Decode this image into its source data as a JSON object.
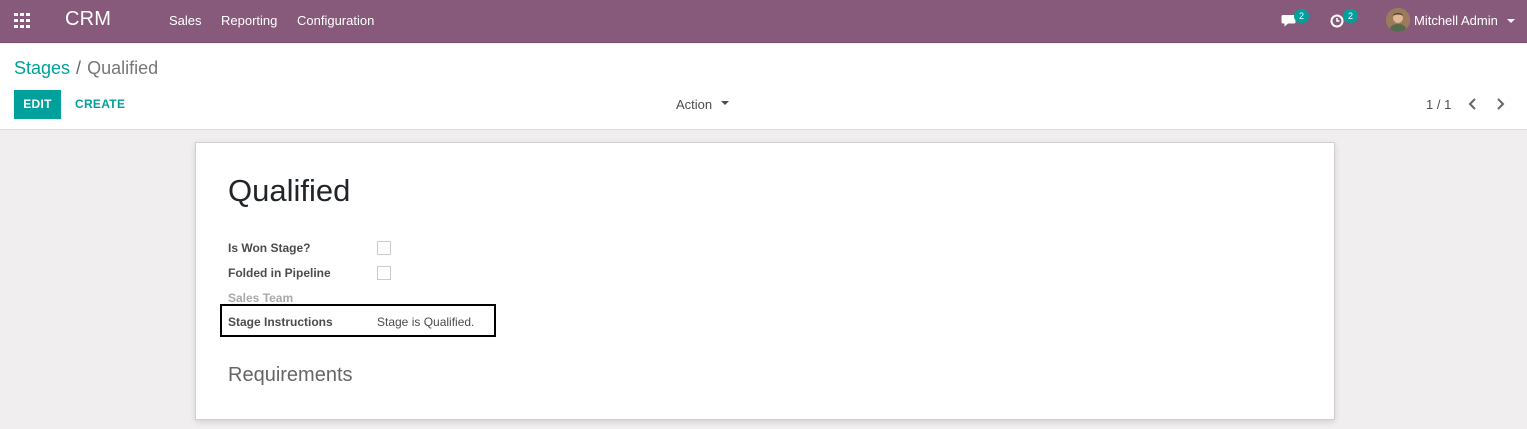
{
  "navbar": {
    "brand": "CRM",
    "menu": [
      "Sales",
      "Reporting",
      "Configuration"
    ],
    "messages_count": "2",
    "activities_count": "2",
    "user_name": "Mitchell Admin",
    "color": "#875a7b"
  },
  "breadcrumb": {
    "parent": "Stages",
    "separator": "/",
    "current": "Qualified"
  },
  "toolbar": {
    "edit_label": "EDIT",
    "create_label": "CREATE",
    "action_label": "Action",
    "pager_value": "1 / 1"
  },
  "form": {
    "title": "Qualified",
    "fields": {
      "is_won_label": "Is Won Stage?",
      "is_won_checked": false,
      "folded_label": "Folded in Pipeline",
      "folded_checked": false,
      "sales_team_label": "Sales Team",
      "instructions_label": "Stage Instructions",
      "instructions_value": "Stage is Qualified."
    },
    "requirements_title": "Requirements"
  },
  "colors": {
    "accent": "#00a09d",
    "navbar": "#875a7b"
  }
}
